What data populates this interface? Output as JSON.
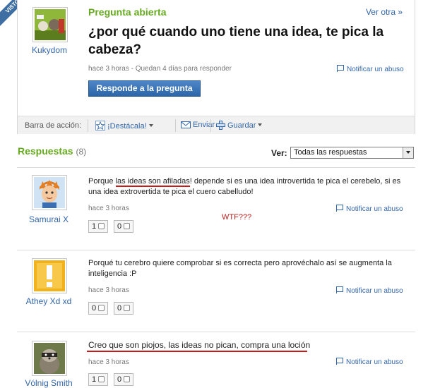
{
  "ribbon": "VISTO",
  "question": {
    "user": "Kukydom",
    "status": "Pregunta abierta",
    "see_other": "Ver otra »",
    "title": "¿por qué cuando uno tiene una idea, te pica la cabeza?",
    "meta": "hace 3 horas - Quedan 4 días para responder",
    "report": "Notificar un abuso",
    "answer_button": "Responde a la pregunta"
  },
  "action_bar": {
    "label": "Barra de acción:",
    "highlight": "¡Destácala!",
    "send": "Enviar",
    "save": "Guardar"
  },
  "responses": {
    "heading": "Respuestas",
    "count": "(8)",
    "filter_label": "Ver:",
    "filter_value": "Todas las respuestas"
  },
  "answers": [
    {
      "user": "Samurai X",
      "text_before": "Porque ",
      "text_highlight": "las ideas son afiladas",
      "text_after": "! depende si es una idea introvertida te pica el cerebelo, si es una idea extrovertida te pica el cuero cabelludo!",
      "time": "hace 3 horas",
      "report": "Notificar un abuso",
      "up": "1",
      "down": "0",
      "note": "WTF???"
    },
    {
      "user": "Athey Xd xd",
      "text": "Porqué tu cerebro quiere comprobar si es correcta pero aprovéchalo así se augmenta la inteligencia :P",
      "time": "hace 3 horas",
      "report": "Notificar un abuso",
      "up": "0",
      "down": "0"
    },
    {
      "user": "Vólnig Smith",
      "text": "Creo que son piojos, las ideas no pican, compra una loción",
      "time": "hace 3 horas",
      "report": "Notificar un abuso",
      "up": "1",
      "down": "0"
    }
  ],
  "colors": {
    "accent_green": "#66aa22",
    "link_blue": "#3366aa",
    "button_blue": "#2d66a8",
    "annotation_red": "#c81c1c"
  }
}
